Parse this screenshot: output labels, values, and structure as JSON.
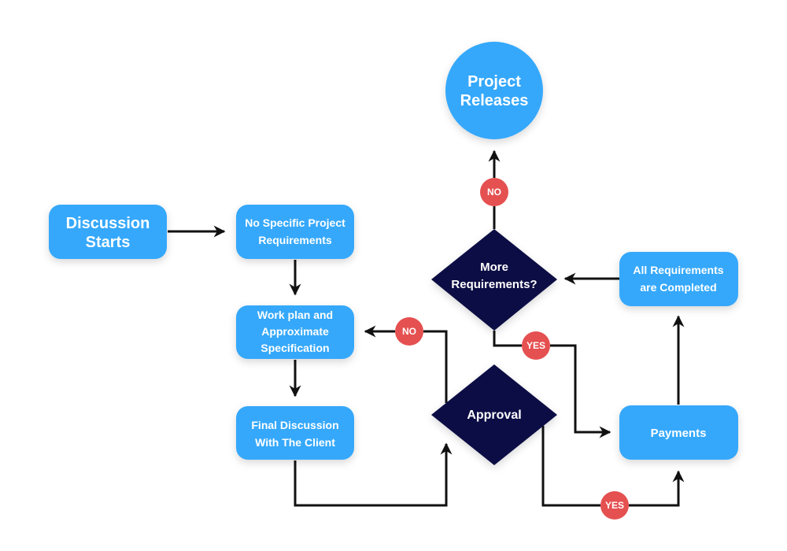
{
  "colors": {
    "process": "#36A8FB",
    "decision": "#0A1045",
    "badge": "#E55050",
    "edge": "#111111"
  },
  "nodes": {
    "discussion_starts": [
      "Discussion",
      "Starts"
    ],
    "no_specific": [
      "No Specific Project",
      "Requirements"
    ],
    "work_plan": [
      "Work plan and",
      "Approximate",
      "Specification"
    ],
    "final_discussion": [
      "Final Discussion",
      "With The Client"
    ],
    "project_releases": [
      "Project",
      "Releases"
    ],
    "more_requirements": [
      "More",
      "Requirements?"
    ],
    "approval": [
      "Approval"
    ],
    "all_requirements": [
      "All Requirements",
      "are Completed"
    ],
    "payments": [
      "Payments"
    ]
  },
  "badges": {
    "more_no": "NO",
    "approval_no": "NO",
    "more_yes": "YES",
    "approval_yes": "YES"
  }
}
